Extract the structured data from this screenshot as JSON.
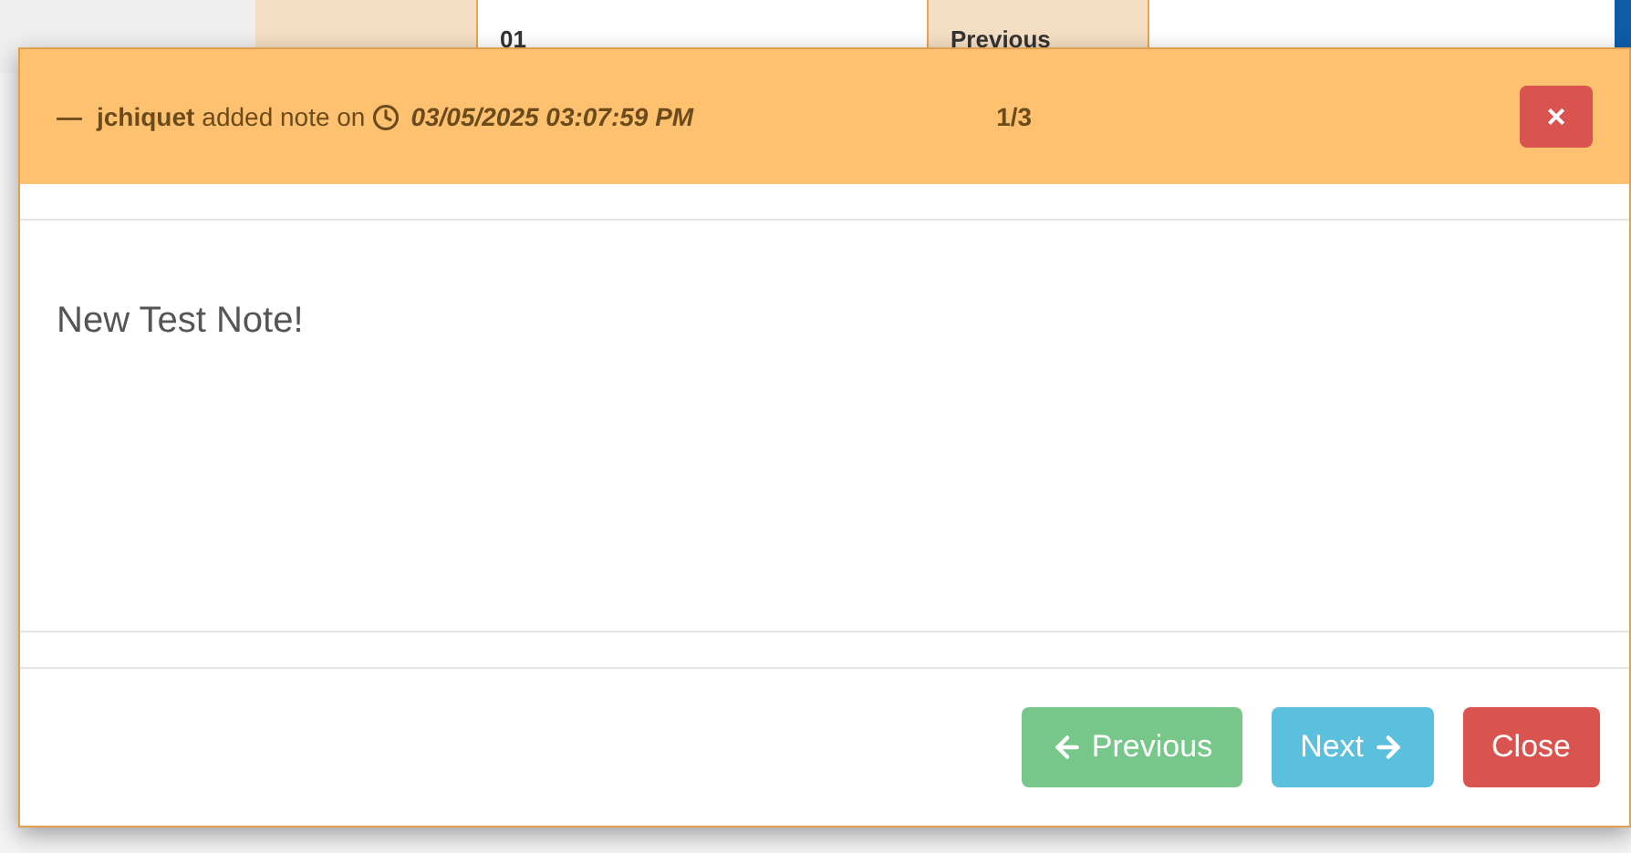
{
  "background_table": {
    "columns": [
      {
        "label": "01"
      },
      {
        "label": "Previous"
      }
    ]
  },
  "note_dialog": {
    "author": "jchiquet",
    "action": "added note on",
    "timestamp": "03/05/2025 03:07:59 PM",
    "counter": "1/3",
    "collapse_glyph": "—",
    "close_glyph": "×",
    "body": "New Test Note!",
    "buttons": [
      {
        "kind": "previous",
        "label": "Previous"
      },
      {
        "kind": "next",
        "label": "Next"
      },
      {
        "kind": "close",
        "label": "Close"
      }
    ]
  }
}
